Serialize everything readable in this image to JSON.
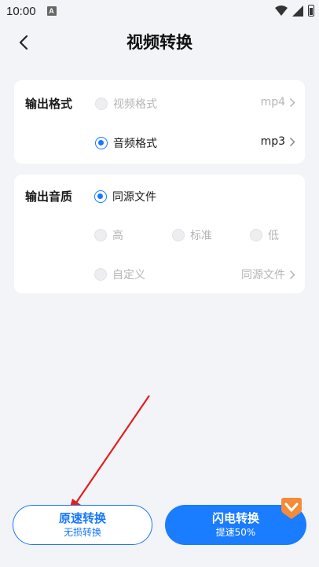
{
  "status_bar": {
    "time": "10:00",
    "app_badge": "A"
  },
  "header": {
    "title": "视频转换"
  },
  "output_format": {
    "label": "输出格式",
    "options": [
      {
        "label": "视频格式",
        "value": "mp4",
        "selected": false,
        "enabled": false
      },
      {
        "label": "音频格式",
        "value": "mp3",
        "selected": true,
        "enabled": true
      }
    ]
  },
  "output_quality": {
    "label": "输出音质",
    "source_option": {
      "label": "同源文件",
      "selected": true
    },
    "levels": [
      {
        "label": "高",
        "selected": false,
        "enabled": false
      },
      {
        "label": "标准",
        "selected": false,
        "enabled": false
      },
      {
        "label": "低",
        "selected": false,
        "enabled": false
      }
    ],
    "custom": {
      "label": "自定义",
      "value": "同源文件",
      "enabled": false
    }
  },
  "actions": {
    "original": {
      "title": "原速转换",
      "subtitle": "无损转换"
    },
    "flash": {
      "title": "闪电转换",
      "subtitle": "提速50%"
    }
  },
  "colors": {
    "accent": "#1677ff",
    "background": "#f3f4f8",
    "annotation_arrow": "#e02020",
    "vip_badge": "#f28c3a"
  }
}
